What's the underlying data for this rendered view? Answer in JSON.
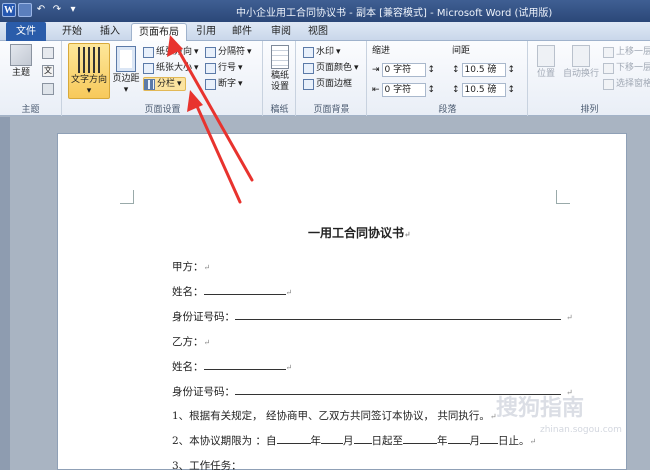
{
  "window": {
    "title": "中小企业用工合同协议书 - 副本 [兼容模式] - Microsoft Word (试用版)"
  },
  "qat": {
    "logo": "W",
    "undo": "↶",
    "redo": "↷"
  },
  "tabs": [
    {
      "label": "文件"
    },
    {
      "label": "开始"
    },
    {
      "label": "插入"
    },
    {
      "label": "页面布局"
    },
    {
      "label": "引用"
    },
    {
      "label": "邮件"
    },
    {
      "label": "审阅"
    },
    {
      "label": "视图"
    }
  ],
  "ribbon": {
    "theme": {
      "themes": "主题",
      "group": "主题"
    },
    "page_setup": {
      "text_direction": "文字方向",
      "margins": "页边距",
      "orientation": "纸张方向",
      "size": "纸张大小",
      "columns": "分栏",
      "breaks": "分隔符",
      "line_numbers": "行号",
      "hyphenation": "断字",
      "group": "页面设置"
    },
    "draft": {
      "draft_paper": "稿纸设置",
      "group": "稿纸"
    },
    "background": {
      "watermark": "水印",
      "page_color": "页面颜色",
      "page_borders": "页面边框",
      "group": "页面背景"
    },
    "paragraph": {
      "indent": "缩进",
      "spacing": "间距",
      "indent_left": "0 字符",
      "indent_right": "0 字符",
      "spacing_before": "10.5 磅",
      "spacing_after": "10.5 磅",
      "group": "段落"
    },
    "arrange": {
      "position": "位置",
      "wrap_text": "自动换行",
      "bring_forward": "上移一层",
      "send_backward": "下移一层",
      "selection_pane": "选择窗格",
      "group": "排列"
    }
  },
  "document": {
    "title": "一用工合同协议书",
    "party_a": "甲方：",
    "name_label_a": "姓名：",
    "id_label_a": "身份证号码：",
    "party_b": "乙方：",
    "name_label_b": "姓名：",
    "id_label_b": "身份证号码：",
    "clause1": "1、根据有关规定， 经协商甲、乙双方共同签订本协议， 共同执行。",
    "clause2_prefix": "2、本协议期限为 ：自",
    "year1": "年",
    "month1": "月",
    "day_to": "日起至",
    "year2": "年",
    "month2": "月",
    "day_end": "日止。",
    "clause3": "3、工作任务：",
    "para_mark": "↵"
  },
  "watermark": {
    "text": "搜狗指南",
    "url": "zhinan.sogou.com"
  },
  "colors": {
    "arrow": "#e8332e",
    "file_tab": "#2a5caa",
    "title_bar": "#2b4778"
  }
}
